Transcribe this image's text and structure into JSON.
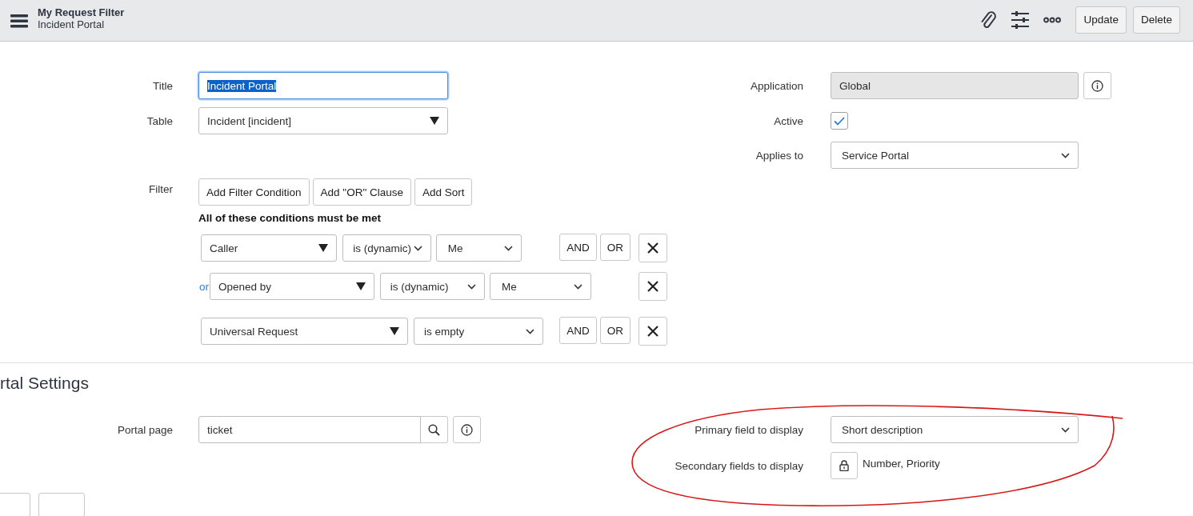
{
  "header": {
    "title": "My Request Filter",
    "subtitle": "Incident Portal",
    "buttons": [
      "Update",
      "Delete"
    ]
  },
  "form": {
    "title": {
      "label": "Title",
      "value": "Incident Portal",
      "text_selected": true
    },
    "table": {
      "label": "Table",
      "value": "Incident [incident]"
    },
    "application": {
      "label": "Application",
      "value": "Global"
    },
    "active": {
      "label": "Active",
      "checked": true
    },
    "applies_to": {
      "label": "Applies to",
      "value": "Service Portal"
    },
    "filter": {
      "label": "Filter",
      "buttons": [
        "Add Filter Condition",
        "Add \"OR\" Clause",
        "Add Sort"
      ],
      "summary": "All of these conditions must be met",
      "conditions": [
        {
          "field": "Caller",
          "operator": "is (dynamic)",
          "value": "Me",
          "actions": [
            "AND",
            "OR"
          ]
        },
        {
          "prefix": "or",
          "field": "Opened by",
          "operator": "is (dynamic)",
          "value": "Me"
        },
        {
          "field": "Universal Request",
          "operator": "is empty",
          "actions": [
            "AND",
            "OR"
          ]
        }
      ]
    }
  },
  "portal_settings": {
    "heading": "rtal Settings",
    "portal_page": {
      "label": "Portal page",
      "value": "ticket"
    },
    "primary_field": {
      "label": "Primary field to display",
      "value": "Short description"
    },
    "secondary_fields": {
      "label": "Secondary fields to display",
      "value": "Number, Priority",
      "locked": true
    }
  }
}
